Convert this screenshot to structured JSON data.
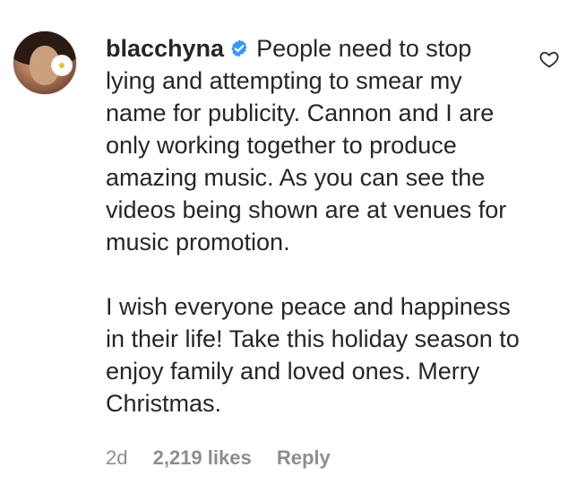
{
  "comment": {
    "username": "blacchyna",
    "verified_icon": "verified-badge-icon",
    "paragraph_1": "People need to stop lying and attempting to smear my name for publicity. Cannon and I are only working together to produce amazing music. As you can see the videos being shown are at venues for music promotion.",
    "paragraph_2": "I wish everyone peace and happiness in their life! Take this holiday season to enjoy family and loved ones. Merry Christmas.",
    "time": "2d",
    "likes": "2,219 likes",
    "reply_label": "Reply",
    "like_icon": "heart-outline-icon",
    "colors": {
      "text": "#262626",
      "meta": "#8e8e8e",
      "verified": "#3897f0"
    }
  }
}
